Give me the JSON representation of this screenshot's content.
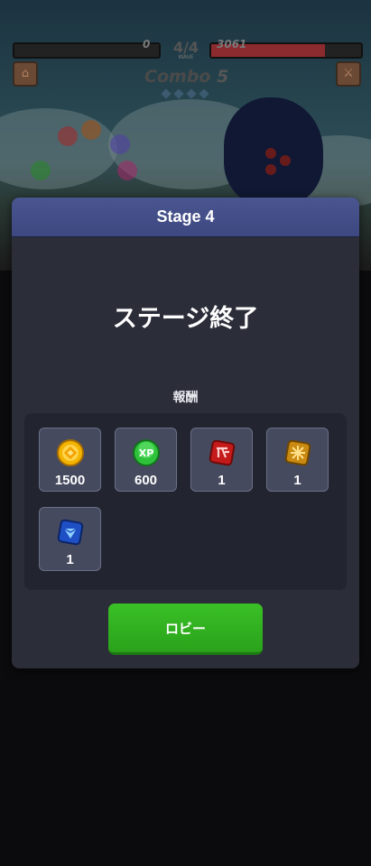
{
  "hud": {
    "player_hp": "0",
    "enemy_hp": "3061",
    "enemy_hp_fraction": 0.76,
    "wave": "4/4",
    "wave_caption": "WAVE",
    "combo_label": "Combo",
    "combo_count": "5",
    "menu_icon": "home-icon",
    "skill_icon": "sword-icon"
  },
  "dialog": {
    "title": "Stage 4",
    "headline": "ステージ終了",
    "rewards_label": "報酬",
    "rewards": [
      {
        "icon": "gold-coin-icon",
        "count": "1500"
      },
      {
        "icon": "xp-orb-icon",
        "count": "600"
      },
      {
        "icon": "red-rune-icon",
        "count": "1"
      },
      {
        "icon": "gold-rune-icon",
        "count": "1"
      },
      {
        "icon": "blue-gem-icon",
        "count": "1"
      }
    ],
    "lobby_button": "ロビー"
  },
  "colors": {
    "header": "#4a5690",
    "panel": "#2b2d39",
    "button": "#2fb21f"
  }
}
